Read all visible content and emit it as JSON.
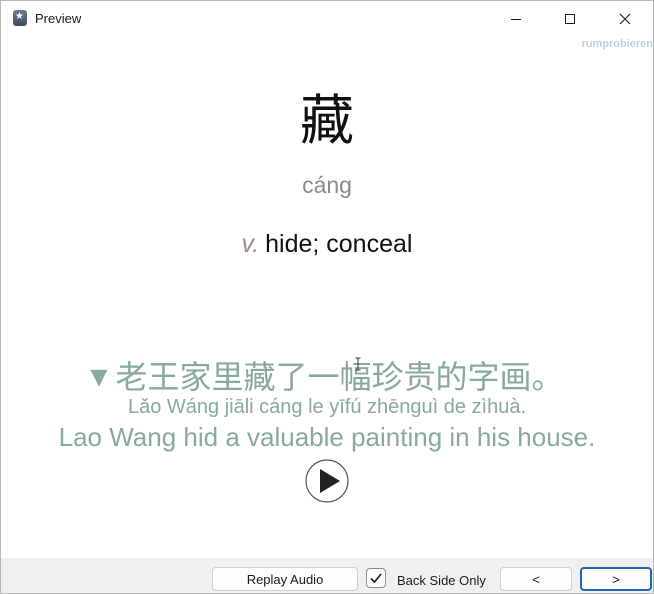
{
  "window": {
    "title": "Preview",
    "watermark": "rumprobieren"
  },
  "card": {
    "hanzi": "藏",
    "pinyin": "cáng",
    "part_of_speech": "v.",
    "definition": "hide; conceal",
    "example": {
      "arrow": "▼",
      "hanzi": "老王家里藏了一幅珍贵的字画。",
      "pinyin": "Lǎo Wáng jiāli cáng le yīfú zhēnguì de zìhuà.",
      "english": "Lao Wang hid a valuable painting in his house."
    }
  },
  "toolbar": {
    "replay_label": "Replay Audio",
    "back_side_only_label": "Back Side Only",
    "back_side_only_checked": true,
    "prev_label": "<",
    "next_label": ">"
  },
  "icons": {
    "app": "anki-star-icon",
    "minimize": "minimize-icon",
    "maximize": "maximize-icon",
    "close": "close-icon",
    "play": "play-icon",
    "checkmark": "checkmark-icon"
  },
  "colors": {
    "example_text": "#88a8a0",
    "pinyin_text": "#8a8a8a",
    "part_of_speech": "#a08c8c",
    "watermark": "#b5d3de",
    "primary_button_border": "#1f62b8"
  }
}
